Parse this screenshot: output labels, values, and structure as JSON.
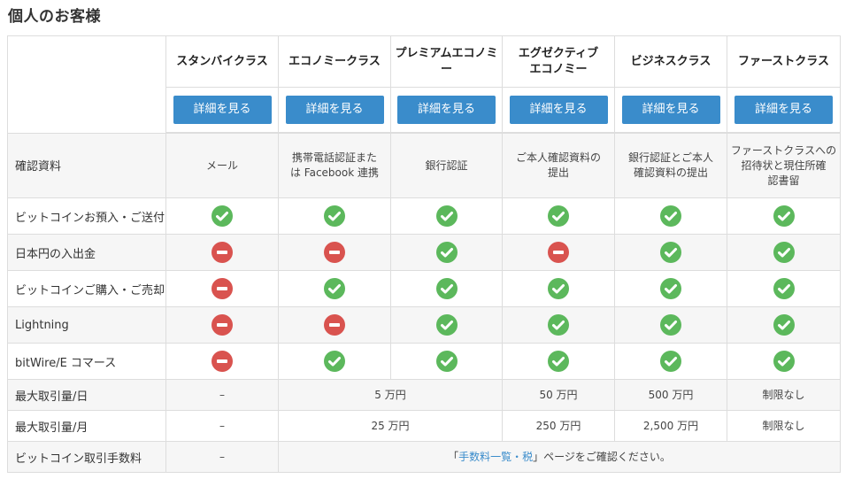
{
  "heading": "個人のお客様",
  "columns": [
    "スタンバイクラス",
    "エコノミークラス",
    "プレミアムエコノミー",
    "エグゼクティブ\nエコノミー",
    "ビジネスクラス",
    "ファーストクラス"
  ],
  "detail_button_label": "詳細を見る",
  "rows": {
    "verification": {
      "label": "確認資料",
      "values": [
        "メール",
        "携帯電話認証また\nは Facebook 連携",
        "銀行認証",
        "ご本人確認資料の\n提出",
        "銀行認証とご本人\n確認資料の提出",
        "ファーストクラスへの\n招待状と現住所確\n認書留"
      ]
    },
    "features": [
      {
        "label": "ビットコインお預入・ご送付",
        "status": [
          "check",
          "check",
          "check",
          "check",
          "check",
          "check"
        ]
      },
      {
        "label": "日本円の入出金",
        "status": [
          "no",
          "no",
          "check",
          "no",
          "check",
          "check"
        ]
      },
      {
        "label": "ビットコインご購入・ご売却",
        "status": [
          "no",
          "check",
          "check",
          "check",
          "check",
          "check"
        ]
      },
      {
        "label": "Lightning",
        "status": [
          "no",
          "no",
          "check",
          "check",
          "check",
          "check"
        ]
      },
      {
        "label": "bitWire/E コマース",
        "status": [
          "no",
          "check",
          "check",
          "check",
          "check",
          "check"
        ]
      }
    ],
    "daily_limit": {
      "label": "最大取引量/日",
      "standby": "–",
      "economy_premium": "5 万円",
      "executive": "50 万円",
      "business": "500 万円",
      "first": "制限なし"
    },
    "monthly_limit": {
      "label": "最大取引量/月",
      "standby": "–",
      "economy_premium": "25 万円",
      "executive": "250 万円",
      "business": "2,500 万円",
      "first": "制限なし"
    },
    "fee": {
      "label": "ビットコイン取引手数料",
      "standby": "–",
      "prefix": "「",
      "link_text": "手数料一覧・税",
      "suffix": "」ページをご確認ください。"
    }
  },
  "colors": {
    "check": "#5cb85c",
    "no": "#d9534f",
    "button": "#3a8ccb",
    "link": "#3a8ccb"
  },
  "icons": {
    "check": "check-circle-icon",
    "no": "no-entry-circle-icon"
  }
}
